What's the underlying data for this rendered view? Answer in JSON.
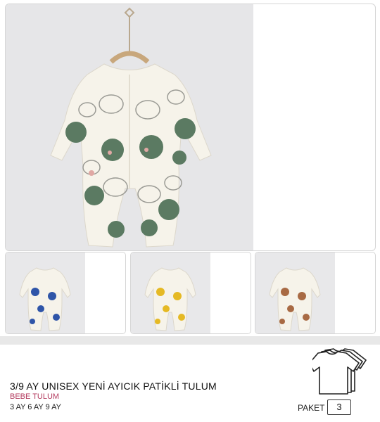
{
  "product": {
    "title": "3/9 AY UNISEX YENİ AYICIK PATİKLİ TULUM",
    "category": "BEBE TULUM",
    "sizes": "3 AY 6 AY 9 AY"
  },
  "package": {
    "label": "PAKET",
    "count": "3"
  },
  "images": {
    "main_color": "green",
    "thumbnails": [
      {
        "color_name": "blue",
        "accent": "#2f55a8"
      },
      {
        "color_name": "yellow",
        "accent": "#e5b924"
      },
      {
        "color_name": "brown",
        "accent": "#a86a44"
      }
    ]
  },
  "icons": {
    "package_icon": "tshirt-stack-icon"
  },
  "colors": {
    "title_text": "#111111",
    "category_text": "#b33a5e",
    "main_accent": "#5b7a62"
  }
}
